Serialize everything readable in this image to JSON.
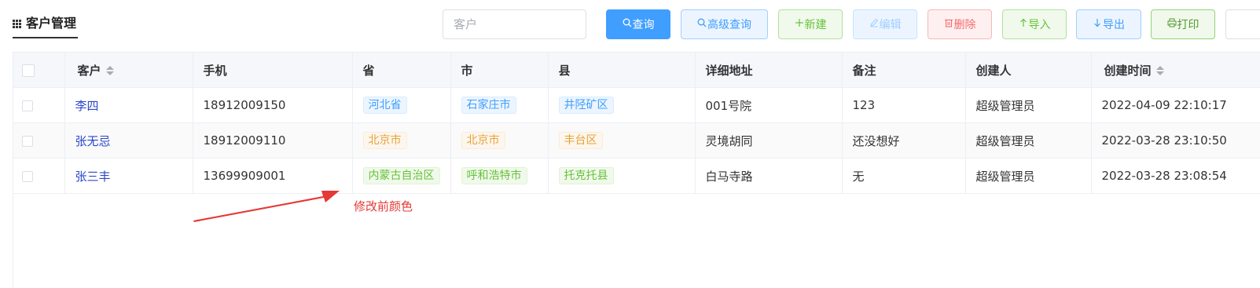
{
  "header": {
    "title": "客户管理",
    "search_placeholder": "客户"
  },
  "toolbar": {
    "query": "查询",
    "advanced_query": "高级查询",
    "new": "新建",
    "edit": "编辑",
    "delete": "删除",
    "import": "导入",
    "export": "导出",
    "print": "打印"
  },
  "table": {
    "columns": [
      "客户",
      "手机",
      "省",
      "市",
      "县",
      "详细地址",
      "备注",
      "创建人",
      "创建时间"
    ],
    "rows": [
      {
        "customer": "李四",
        "phone": "18912009150",
        "province": "河北省",
        "city": "石家庄市",
        "county": "井陉矿区",
        "address": "001号院",
        "remark": "123",
        "creator": "超级管理员",
        "created": "2022-04-09 22:10:17",
        "tag_color": "blue"
      },
      {
        "customer": "张无忌",
        "phone": "18912009110",
        "province": "北京市",
        "city": "北京市",
        "county": "丰台区",
        "address": "灵境胡同",
        "remark": "还没想好",
        "creator": "超级管理员",
        "created": "2022-03-28 23:10:50",
        "tag_color": "orange"
      },
      {
        "customer": "张三丰",
        "phone": "13699909001",
        "province": "内蒙古自治区",
        "city": "呼和浩特市",
        "county": "托克托县",
        "address": "白马寺路",
        "remark": "无",
        "creator": "超级管理员",
        "created": "2022-03-28 23:08:54",
        "tag_color": "green"
      }
    ]
  },
  "annotation": {
    "text": "修改前颜色",
    "color": "#e53935"
  },
  "colors": {
    "primary": "#409eff",
    "success": "#67c23a",
    "danger": "#f56c6c",
    "warning": "#e6a23c"
  }
}
